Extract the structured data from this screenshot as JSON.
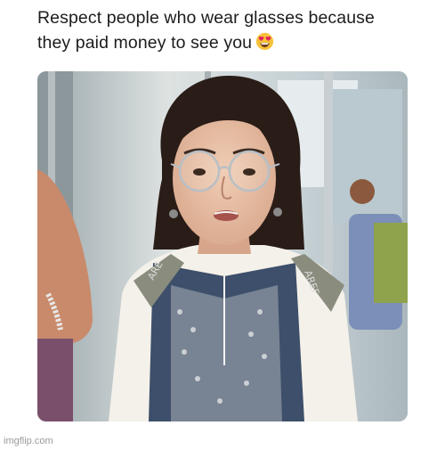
{
  "caption": {
    "line1": "Respect people who wear glasses because",
    "line2": "they paid money to see you",
    "emoji": "heart-eyes-emoji"
  },
  "photo": {
    "subject": "photo-woman-with-glasses"
  },
  "bag_strap_text": {
    "left": "ARE",
    "right": "AREF"
  },
  "watermark": "imgflip.com",
  "colors": {
    "caption_text": "#1c1c1c",
    "background": "#ffffff",
    "watermark": "#9a9a9a"
  }
}
